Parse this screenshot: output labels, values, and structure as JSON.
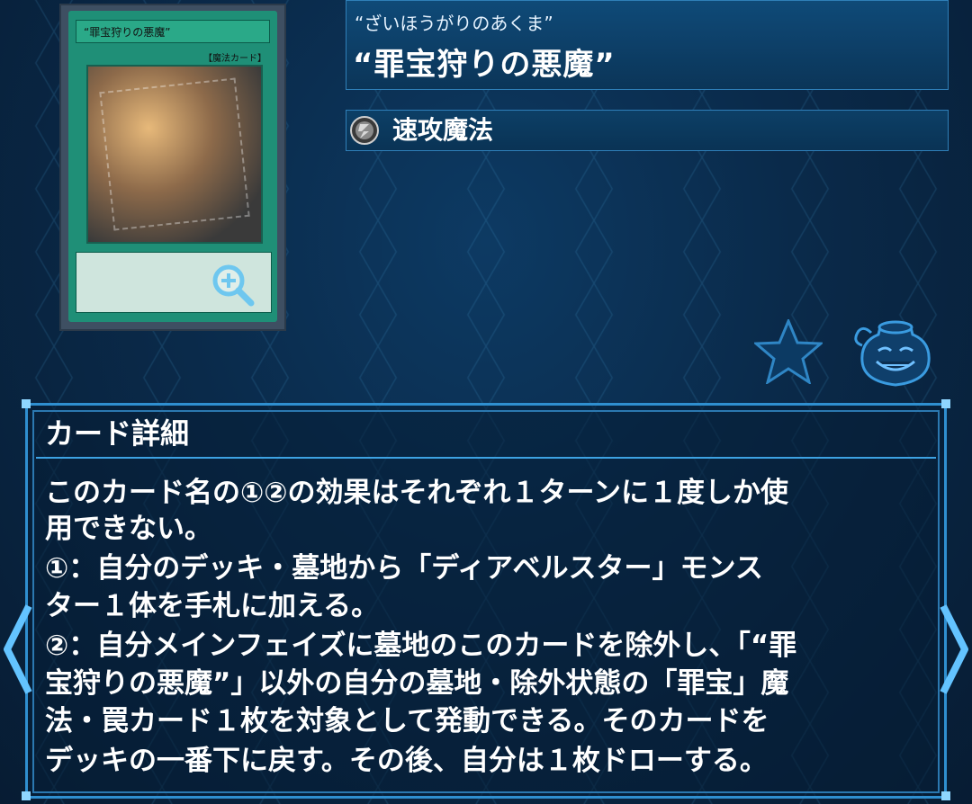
{
  "card": {
    "image_name_text": "“罪宝狩りの悪魔”",
    "image_type_text": "【魔法カード】"
  },
  "header": {
    "ruby": "“ざいほうがりのあくま”",
    "name": "“罪宝狩りの悪魔”",
    "type": "速攻魔法"
  },
  "detail": {
    "title": "カード詳細",
    "lines": [
      "このカード名の①②の効果はそれぞれ１ターンに１度しか使",
      "用できない。",
      "①：自分のデッキ・墓地から「ディアベルスター」モンス",
      "ター１体を手札に加える。",
      "②：自分メインフェイズに墓地のこのカードを除外し、「“罪",
      "宝狩りの悪魔”」以外の自分の墓地・除外状態の「罪宝」魔",
      "法・罠カード１枚を対象として発動できる。そのカードを",
      "デッキの一番下に戻す。その後、自分は１枚ドローする。"
    ]
  },
  "icons": {
    "zoom": "zoom-in-icon",
    "spell_type": "quick-play-spell-icon",
    "favorite": "star-icon",
    "pot": "pot-of-greed-icon",
    "prev": "chevron-left-icon",
    "next": "chevron-right-icon"
  },
  "colors": {
    "panel_border": "#2f8fd0",
    "card_frame": "#1f8f77",
    "accent": "#3da2e2"
  }
}
